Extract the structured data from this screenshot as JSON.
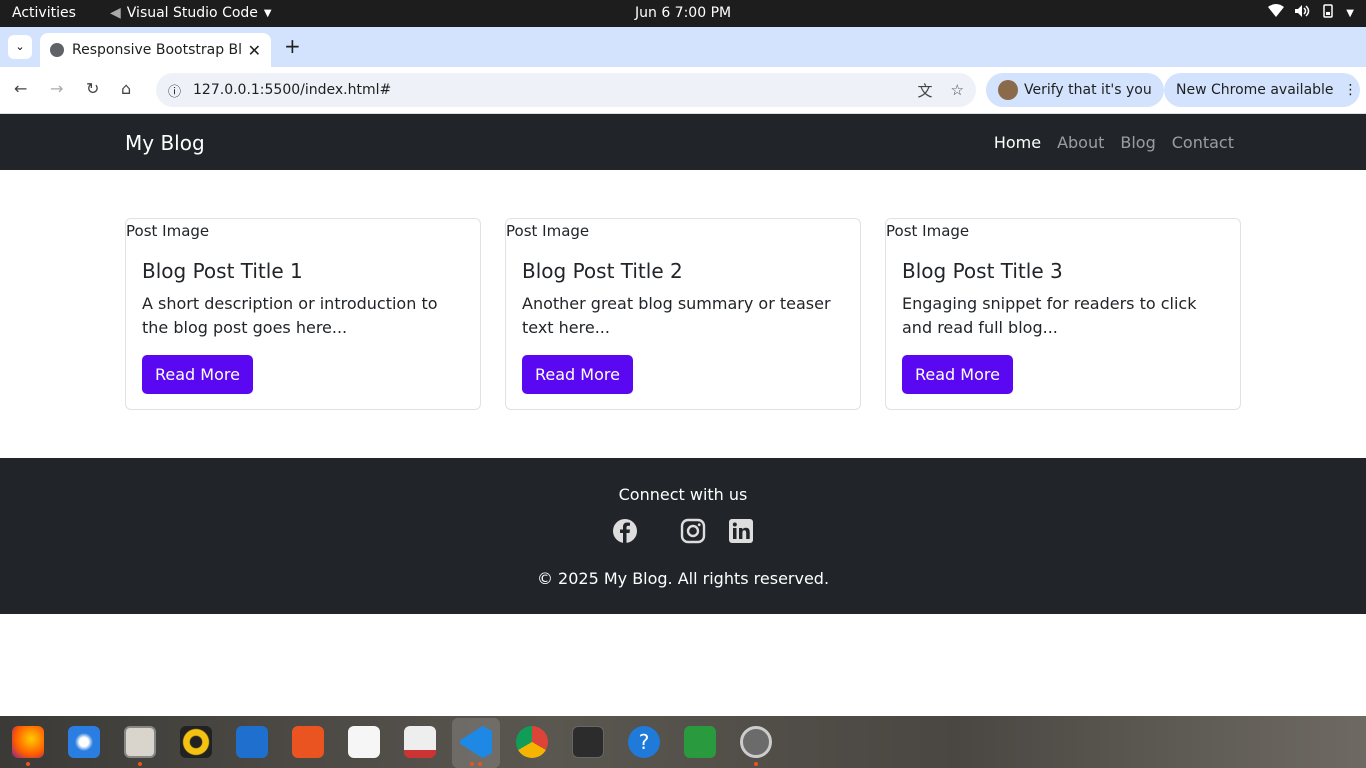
{
  "system": {
    "activities": "Activities",
    "app_name": "Visual Studio Code",
    "datetime": "Jun 6   7:00 PM"
  },
  "browser": {
    "tab_title": "Responsive Bootstrap Bl",
    "url": "127.0.0.1:5500/index.html#",
    "verify_label": "Verify that it's you",
    "update_label": "New Chrome available"
  },
  "site": {
    "brand": "My Blog",
    "nav": [
      "Home",
      "About",
      "Blog",
      "Contact"
    ],
    "posts": [
      {
        "image_alt": "Post Image",
        "title": "Blog Post Title 1",
        "text": "A short description or introduction to the blog post goes here...",
        "button": "Read More"
      },
      {
        "image_alt": "Post Image",
        "title": "Blog Post Title 2",
        "text": "Another great blog summary or teaser text here...",
        "button": "Read More"
      },
      {
        "image_alt": "Post Image",
        "title": "Blog Post Title 3",
        "text": "Engaging snippet for readers to click and read full blog...",
        "button": "Read More"
      }
    ],
    "footer": {
      "connect": "Connect with us",
      "copyright": "© 2025 My Blog. All rights reserved."
    }
  },
  "colors": {
    "navbar": "#212529",
    "button": "#5b08f2",
    "tabbar": "#d3e3fd"
  },
  "dock_apps": [
    "firefox-icon",
    "thunderbird-icon",
    "files-icon",
    "rhythmbox-icon",
    "writer-icon",
    "app-center-icon",
    "text-editor-icon",
    "document-viewer-icon",
    "vscode-icon",
    "chrome-icon",
    "terminal-icon",
    "help-icon",
    "calc-icon",
    "settings-icon"
  ]
}
